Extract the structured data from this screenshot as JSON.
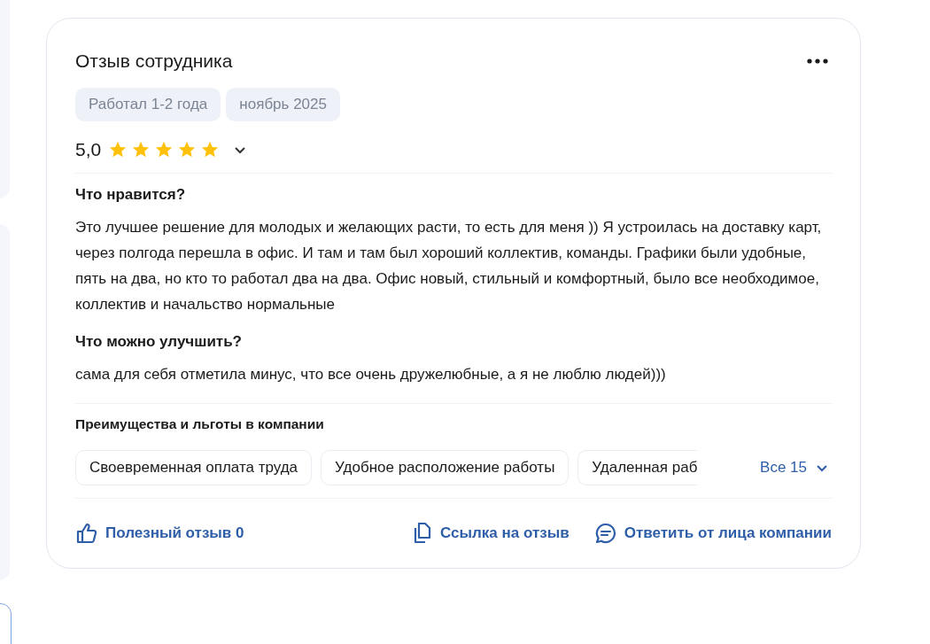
{
  "review": {
    "title": "Отзыв сотрудника",
    "tags": [
      "Работал 1-2 года",
      "ноябрь 2025"
    ],
    "rating": "5,0",
    "stars": 5,
    "sections": [
      {
        "heading": "Что нравится?",
        "text": "Это лучшее решение для молодых и желающих расти, то есть для меня )) Я устроилась на доставку карт, через полгода перешла в офис. И там и там был хороший коллектив, команды. Графики были удобные, пять на два, но кто то работал два на два. Офис новый, стильный и комфортный, было все необходимое, коллектив и начальство нормальные"
      },
      {
        "heading": "Что можно улучшить?",
        "text": "сама для себя отметила минус, что все очень дружелюбные, а я не люблю людей)))"
      }
    ],
    "benefits": {
      "heading": "Преимущества и льготы в компании",
      "chips": [
        "Своевременная оплата труда",
        "Удобное расположение работы",
        "Удаленная раб"
      ],
      "more": "Все 15"
    },
    "actions": [
      {
        "kind": "like",
        "label": "Полезный отзыв 0"
      },
      {
        "kind": "link",
        "label": "Ссылка на отзыв"
      },
      {
        "kind": "reply",
        "label": "Ответить от лица компании"
      }
    ]
  }
}
